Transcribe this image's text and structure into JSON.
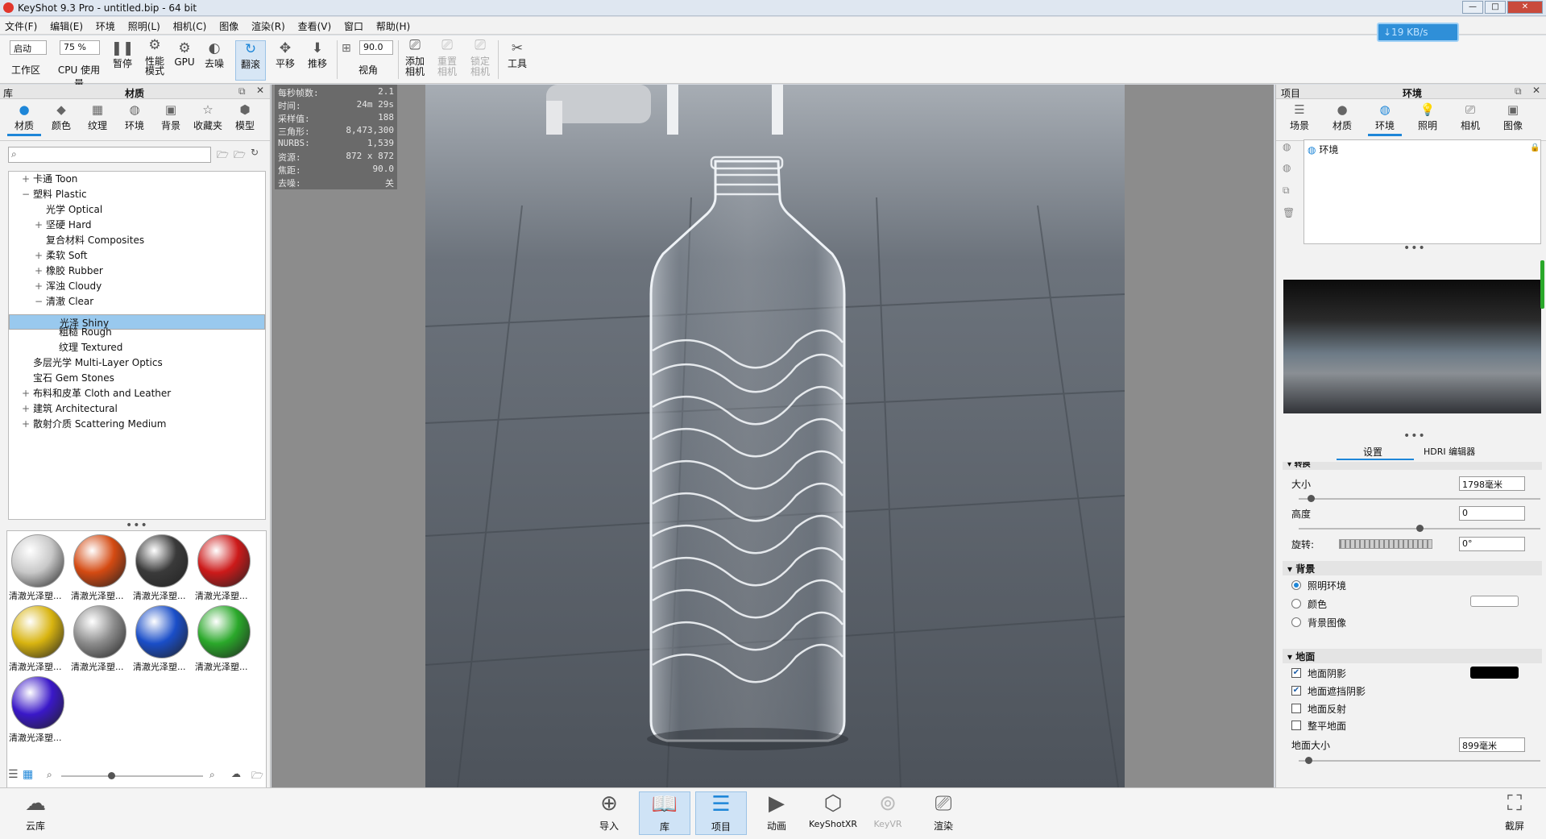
{
  "window": {
    "title": "KeyShot 9.3 Pro  - untitled.bip  - 64 bit",
    "minimize": "—",
    "maximize": "□",
    "close": "✕"
  },
  "menu": [
    "文件(F)",
    "编辑(E)",
    "环境",
    "照明(L)",
    "相机(C)",
    "图像",
    "渲染(R)",
    "查看(V)",
    "窗口",
    "帮助(H)"
  ],
  "toolbar": {
    "workspace_value": "启动",
    "workspace_label": "工作区",
    "cpu_value": "75 %",
    "cpu_label": "CPU 使用量",
    "pause": "暂停",
    "perf_mode": "性能\n模式",
    "gpu": "GPU",
    "denoise": "去噪",
    "tumble": "翻滚",
    "pan": "平移",
    "dolly": "推移",
    "fov_value": "90.0",
    "fov_label": "视角",
    "add_camera": "添加\n相机",
    "reset_camera": "重置\n相机",
    "lock_camera": "锁定\n相机",
    "tools": "工具",
    "speed": "↓19 KB/s"
  },
  "library": {
    "header": "库",
    "title": "材质",
    "tabs": [
      "材质",
      "颜色",
      "纹理",
      "环境",
      "背景",
      "收藏夹",
      "模型"
    ],
    "search_placeholder": "",
    "tree": [
      {
        "label": "卡通 Toon",
        "pm": "+",
        "indent": 0
      },
      {
        "label": "塑料 Plastic",
        "pm": "−",
        "indent": 0
      },
      {
        "label": "光学 Optical",
        "pm": "",
        "indent": 1
      },
      {
        "label": "坚硬 Hard",
        "pm": "+",
        "indent": 1
      },
      {
        "label": "复合材料 Composites",
        "pm": "",
        "indent": 1
      },
      {
        "label": "柔软 Soft",
        "pm": "+",
        "indent": 1
      },
      {
        "label": "橡胶 Rubber",
        "pm": "+",
        "indent": 1
      },
      {
        "label": "浑浊 Cloudy",
        "pm": "+",
        "indent": 1
      },
      {
        "label": "清澈 Clear",
        "pm": "−",
        "indent": 1
      },
      {
        "label": "光泽 Shiny",
        "pm": "",
        "indent": 2,
        "selected": true
      },
      {
        "label": "粗糙 Rough",
        "pm": "",
        "indent": 2
      },
      {
        "label": "纹理 Textured",
        "pm": "",
        "indent": 2
      },
      {
        "label": "多层光学 Multi-Layer Optics",
        "pm": "",
        "indent": 0
      },
      {
        "label": "宝石 Gem Stones",
        "pm": "",
        "indent": 0
      },
      {
        "label": "布料和皮革 Cloth and Leather",
        "pm": "+",
        "indent": 0
      },
      {
        "label": "建筑 Architectural",
        "pm": "+",
        "indent": 0
      },
      {
        "label": "散射介质 Scattering Medium",
        "pm": "+",
        "indent": 0
      }
    ],
    "materials": [
      {
        "label": "清澈光泽塑...",
        "color": "#c8c8c8"
      },
      {
        "label": "清澈光泽塑...",
        "color": "#d44a12"
      },
      {
        "label": "清澈光泽塑...",
        "color": "#3a3a3a"
      },
      {
        "label": "清澈光泽塑...",
        "color": "#cc1a1a"
      },
      {
        "label": "清澈光泽塑...",
        "color": "#d8b410"
      },
      {
        "label": "清澈光泽塑...",
        "color": "#8c8c8c"
      },
      {
        "label": "清澈光泽塑...",
        "color": "#1a4ec8"
      },
      {
        "label": "清澈光泽塑...",
        "color": "#2aa82a"
      },
      {
        "label": "清澈光泽塑...",
        "color": "#3a18c8"
      }
    ]
  },
  "stats": [
    {
      "k": "每秒帧数:",
      "v": "2.1"
    },
    {
      "k": "时间:",
      "v": "24m 29s"
    },
    {
      "k": "采样值:",
      "v": "188"
    },
    {
      "k": "三角形:",
      "v": "8,473,300"
    },
    {
      "k": "NURBS:",
      "v": "1,539"
    },
    {
      "k": "资源:",
      "v": "872 x 872"
    },
    {
      "k": "焦距:",
      "v": "90.0"
    },
    {
      "k": "去噪:",
      "v": "关"
    }
  ],
  "project": {
    "header": "项目",
    "title": "环境",
    "tabs": [
      "场景",
      "材质",
      "环境",
      "照明",
      "相机",
      "图像"
    ],
    "env_item": "环境",
    "subtabs": [
      "设置",
      "HDRI 编辑器"
    ],
    "transform_section": "转换",
    "size_label": "大小",
    "size_value": "1798毫米",
    "size_level": 0.05,
    "height_label": "高度",
    "height_value": "0",
    "height_level": 0.5,
    "rotate_label": "旋转:",
    "rotate_value": "0°",
    "bg_section": "背景",
    "bg_options": [
      "照明环境",
      "颜色",
      "背景图像"
    ],
    "ground_section": "地面",
    "ground_options": [
      {
        "label": "地面阴影",
        "checked": true
      },
      {
        "label": "地面遮挡阴影",
        "checked": true
      },
      {
        "label": "地面反射",
        "checked": false
      },
      {
        "label": "整平地面",
        "checked": false
      }
    ],
    "ground_size_label": "地面大小",
    "ground_size_value": "899毫米",
    "ground_size_level": 0.04,
    "bg_color": "#ffffff",
    "shadow_color": "#000000"
  },
  "bottom": {
    "cloud": "云库",
    "import": "导入",
    "library": "库",
    "project": "项目",
    "animation": "动画",
    "keyshotxr": "KeyShotXR",
    "keyvr": "KeyVR",
    "render": "渲染",
    "screenshot": "截屏"
  },
  "colors": {
    "accent": "#1e86d8",
    "selection": "#99c9ee"
  }
}
